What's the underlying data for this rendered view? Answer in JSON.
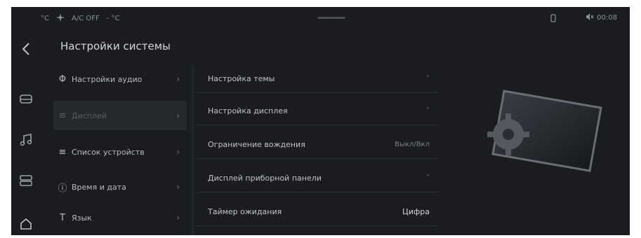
{
  "statusbar": {
    "left_items": [
      "°C",
      "A/C OFF",
      "- °C"
    ],
    "time": "00:08"
  },
  "title": "Настройки системы",
  "menu": [
    {
      "label": "Настройки аудио",
      "icon": "audio-icon",
      "active": false
    },
    {
      "label": "Дисплей",
      "icon": "display-icon",
      "active": true
    },
    {
      "label": "Список устройств",
      "icon": "devices-icon",
      "active": false
    },
    {
      "label": "Время и дата",
      "icon": "clock-icon",
      "active": false
    },
    {
      "label": "Язык",
      "icon": "language-icon",
      "active": false
    }
  ],
  "settings": [
    {
      "label": "Настройка темы",
      "value": "˅"
    },
    {
      "label": "Настройка дисплея",
      "value": "˅"
    },
    {
      "label": "Ограничение вождения",
      "value": "Выкл/Вкл"
    },
    {
      "label": "Дисплей приборной панели",
      "value": "˅"
    },
    {
      "label": "Таймер ожидания",
      "value": "Цифра"
    }
  ],
  "rail_icons": [
    "back-icon",
    "car-icon",
    "music-icon",
    "apps-icon",
    "home-icon"
  ]
}
